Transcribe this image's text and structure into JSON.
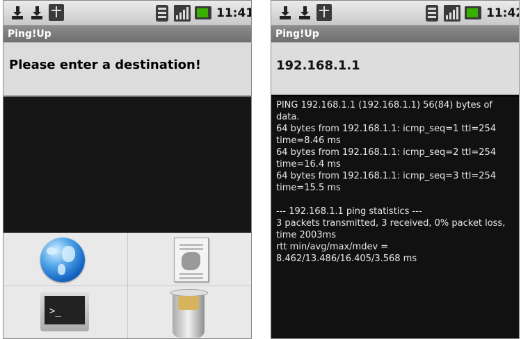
{
  "app": {
    "title": "Ping!Up"
  },
  "left_screen": {
    "status": {
      "time": "11:41"
    },
    "destination_prompt": "Please enter a destination!",
    "menu": [
      {
        "icon": "globe-icon"
      },
      {
        "icon": "document-icon"
      },
      {
        "icon": "terminal-icon"
      },
      {
        "icon": "trash-icon"
      }
    ]
  },
  "right_screen": {
    "status": {
      "time": "11:42"
    },
    "destination": "192.168.1.1",
    "output_text": "PING 192.168.1.1 (192.168.1.1) 56(84) bytes of data.\n64 bytes from 192.168.1.1: icmp_seq=1 ttl=254 time=8.46 ms\n64 bytes from 192.168.1.1: icmp_seq=2 ttl=254 time=16.4 ms\n64 bytes from 192.168.1.1: icmp_seq=3 ttl=254 time=15.5 ms\n\n--- 192.168.1.1 ping statistics ---\n3 packets transmitted, 3 received, 0% packet loss, time 2003ms\nrtt min/avg/max/mdev =\n8.462/13.486/16.405/3.568 ms"
  },
  "colors": {
    "status_bar": "#d8d8d8",
    "title_bar": "#7a7a7a",
    "panel": "#dcdcdc",
    "background": "#111111",
    "battery": "#38b000"
  }
}
